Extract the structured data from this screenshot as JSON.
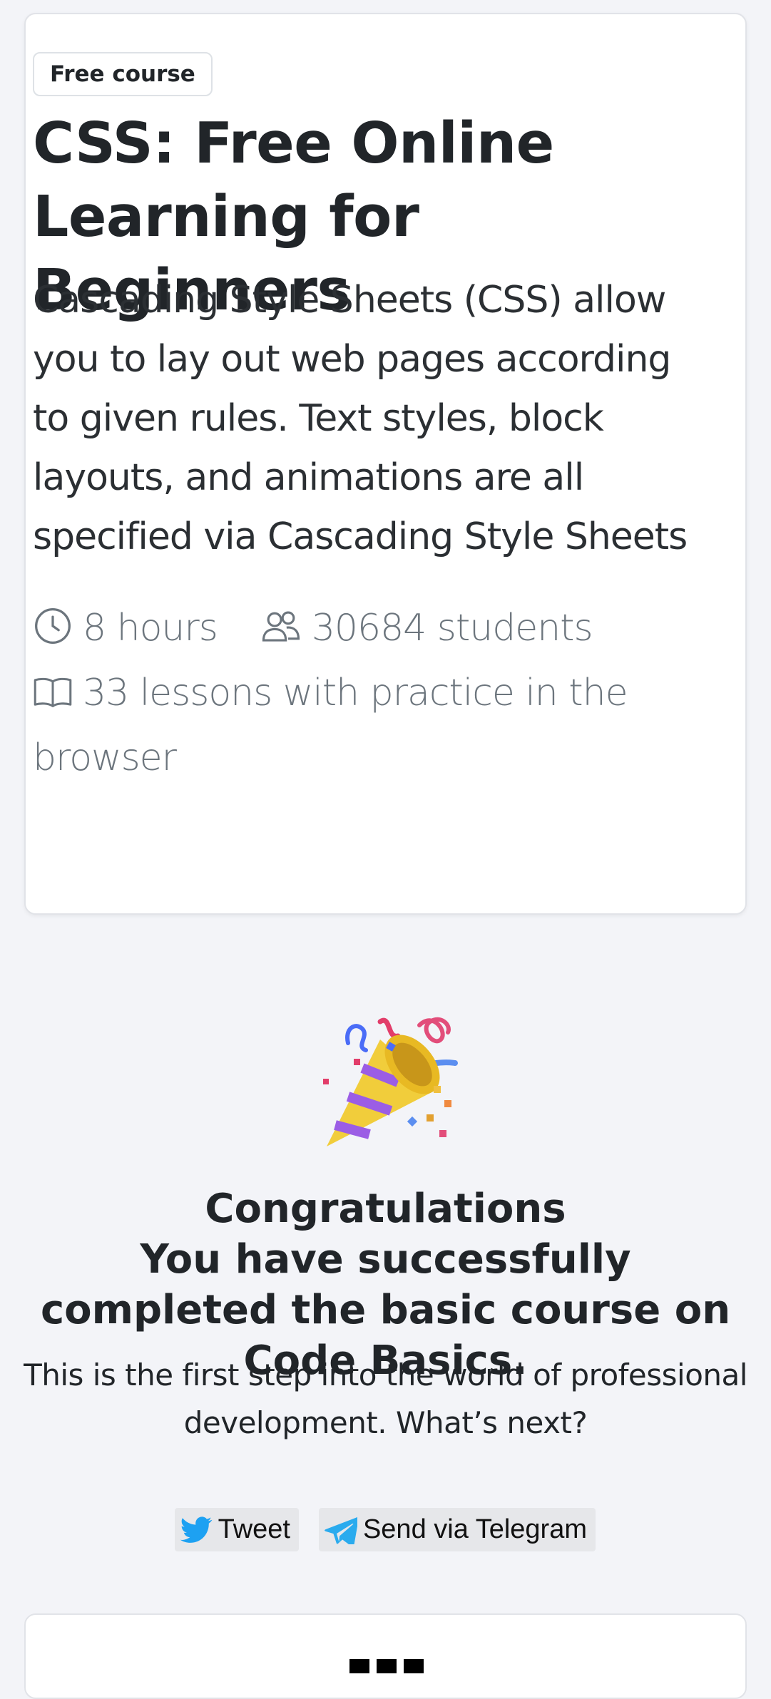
{
  "course": {
    "badge": "Free course",
    "title": "CSS: Free Online Learning for Beginners",
    "description": "Cascading Style Sheets (CSS) allow you to lay out web pages according to given rules. Text styles, block layouts, and animations are all specified via Cascading Style Sheets",
    "duration": "8 hours",
    "students": "30684 students",
    "lessons": "33 lessons with practice in the browser",
    "icons": [
      "clock-icon",
      "people-icon",
      "book-icon"
    ]
  },
  "completion": {
    "icon": "party-popper-icon",
    "heading_line1": "Congratulations",
    "heading_line2": "You have successfully completed the basic course on Code Basics.",
    "subtext": "This is the first step into the world of professional development. What’s next?"
  },
  "share": {
    "tweet_label": "Tweet",
    "telegram_label": "Send via Telegram",
    "colors": {
      "twitter": "#1da1f2",
      "telegram": "#2aabee",
      "button_bg": "#e6e7ea"
    }
  },
  "colors": {
    "page_bg": "#f3f4f8",
    "card_bg": "#ffffff",
    "text": "#212529",
    "muted": "#6c757d"
  }
}
